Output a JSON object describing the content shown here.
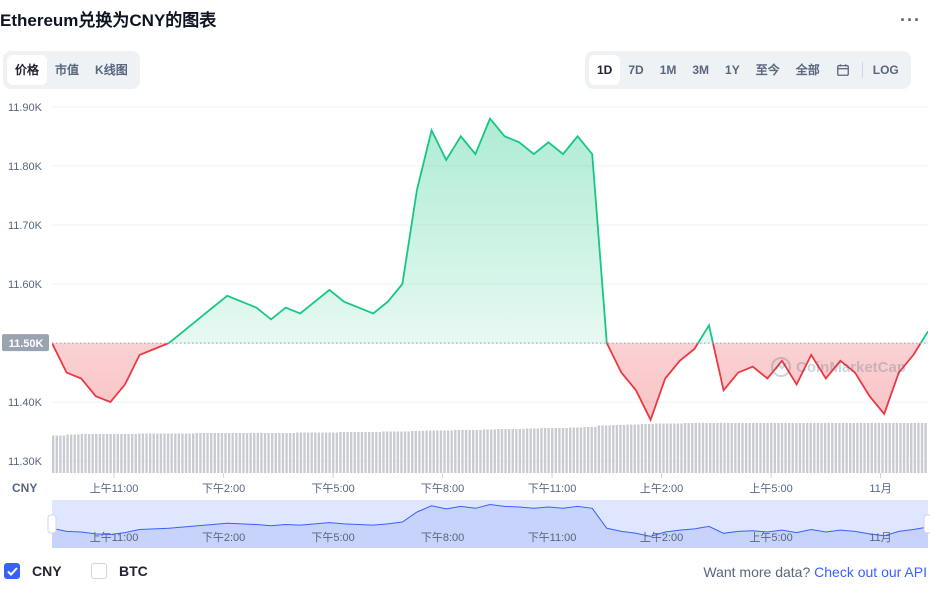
{
  "title": "Ethereum兑换为CNY的图表",
  "more_icon": "more-horizontal-icon",
  "view_tabs": [
    {
      "label": "价格",
      "active": true
    },
    {
      "label": "市值",
      "active": false
    },
    {
      "label": "K线图",
      "active": false
    }
  ],
  "range_tabs": [
    {
      "label": "1D",
      "active": true
    },
    {
      "label": "7D",
      "active": false
    },
    {
      "label": "1M",
      "active": false
    },
    {
      "label": "3M",
      "active": false
    },
    {
      "label": "1Y",
      "active": false
    },
    {
      "label": "至今",
      "active": false
    },
    {
      "label": "全部",
      "active": false
    }
  ],
  "calendar_icon": "calendar-icon",
  "log_label": "LOG",
  "currency_axis_label": "CNY",
  "watermark": "CoinMarketCap",
  "colors": {
    "up": "#16c784",
    "down": "#ea3943",
    "accent": "#3861fb",
    "navigator_fill": "#dfe6ff",
    "volume": "#c8ccd2"
  },
  "chart_data": {
    "type": "line",
    "title": "Ethereum兑换为CNY的图表",
    "ylabel": "CNY",
    "ylim": [
      11280,
      11920
    ],
    "yticks": [
      11300,
      11400,
      11500,
      11600,
      11700,
      11800,
      11900
    ],
    "ytick_labels": [
      "11.30K",
      "11.40K",
      "11.50K",
      "11.60K",
      "11.70K",
      "11.80K",
      "11.90K"
    ],
    "baseline": 11500,
    "baseline_label": "11.50K",
    "x_hours": [
      0,
      0.4,
      0.8,
      1.2,
      1.6,
      2.0,
      2.4,
      2.8,
      3.2,
      3.6,
      4.0,
      4.4,
      4.8,
      5.2,
      5.6,
      6.0,
      6.4,
      6.8,
      7.2,
      7.6,
      8.0,
      8.4,
      8.8,
      9.2,
      9.6,
      10.0,
      10.4,
      10.8,
      11.2,
      11.6,
      12.0,
      12.4,
      12.8,
      13.2,
      13.6,
      14.0,
      14.4,
      14.8,
      15.2,
      15.6,
      16.0,
      16.4,
      16.8,
      17.2,
      17.6,
      18.0,
      18.4,
      18.8,
      19.2,
      19.6,
      20.0,
      20.4,
      20.8,
      21.2,
      21.6,
      22.0,
      22.4,
      22.8,
      23.2,
      23.6,
      24.0
    ],
    "prices": [
      11500,
      11450,
      11440,
      11410,
      11400,
      11430,
      11480,
      11490,
      11500,
      11520,
      11540,
      11560,
      11580,
      11570,
      11560,
      11540,
      11560,
      11550,
      11570,
      11590,
      11570,
      11560,
      11550,
      11570,
      11600,
      11760,
      11860,
      11810,
      11850,
      11820,
      11880,
      11850,
      11840,
      11820,
      11840,
      11820,
      11850,
      11820,
      11500,
      11450,
      11420,
      11370,
      11440,
      11470,
      11490,
      11530,
      11420,
      11450,
      11460,
      11440,
      11470,
      11430,
      11480,
      11440,
      11470,
      11450,
      11410,
      11380,
      11450,
      11480,
      11520
    ],
    "volumes": [
      0.75,
      0.77,
      0.78,
      0.78,
      0.78,
      0.78,
      0.79,
      0.79,
      0.79,
      0.79,
      0.8,
      0.8,
      0.8,
      0.8,
      0.8,
      0.8,
      0.8,
      0.81,
      0.81,
      0.81,
      0.82,
      0.82,
      0.82,
      0.83,
      0.83,
      0.84,
      0.85,
      0.85,
      0.86,
      0.86,
      0.87,
      0.88,
      0.88,
      0.89,
      0.9,
      0.9,
      0.91,
      0.92,
      0.95,
      0.96,
      0.97,
      0.98,
      0.99,
      0.99,
      1.0,
      1.0,
      1.0,
      1.0,
      1.0,
      1.0,
      1.0,
      1.0,
      1.0,
      1.0,
      1.0,
      1.0,
      1.0,
      1.0,
      1.0,
      1.0,
      1.0
    ],
    "x_tick_hours": [
      1.7,
      4.7,
      7.7,
      10.7,
      13.7,
      16.7,
      19.7,
      22.7
    ],
    "x_tick_labels": [
      "上午11:00",
      "下午2:00",
      "下午5:00",
      "下午8:00",
      "下午11:00",
      "上午2:00",
      "上午5:00",
      "11月"
    ]
  },
  "legend": [
    {
      "label": "CNY",
      "checked": true
    },
    {
      "label": "BTC",
      "checked": false
    }
  ],
  "cta_text": "Want more data?",
  "cta_link": "Check out our API"
}
